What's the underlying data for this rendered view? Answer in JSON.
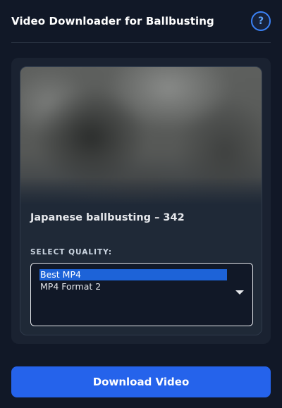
{
  "header": {
    "title": "Video Downloader for Ballbusting",
    "help_label": "?"
  },
  "video": {
    "title": "Japanese ballbusting – 342"
  },
  "quality": {
    "label": "SELECT QUALITY:",
    "options": [
      {
        "label": "Best MP4",
        "selected": true
      },
      {
        "label": "MP4 Format 2",
        "selected": false
      }
    ]
  },
  "actions": {
    "download_label": "Download Video"
  },
  "colors": {
    "background": "#111827",
    "accent": "#2563eb",
    "selection": "#1d63d8",
    "help_ring": "#3b82f6"
  }
}
